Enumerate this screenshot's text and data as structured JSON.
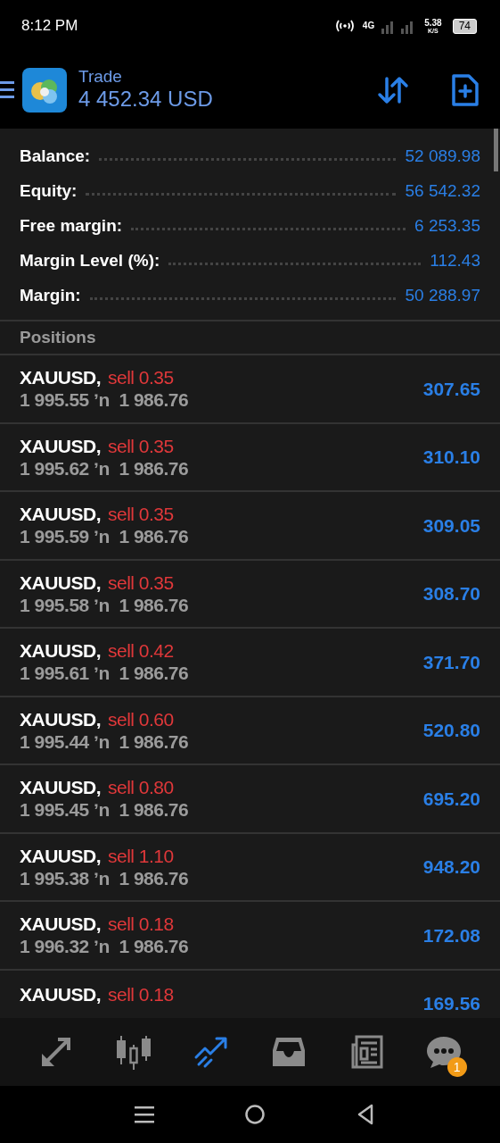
{
  "status_bar": {
    "time": "8:12 PM",
    "network": "4G",
    "speed": "5.38",
    "speed_unit": "K/S",
    "battery": "74"
  },
  "header": {
    "title": "Trade",
    "subtitle": "4 452.34 USD"
  },
  "summary": [
    {
      "label": "Balance:",
      "value": "52 089.98"
    },
    {
      "label": "Equity:",
      "value": "56 542.32"
    },
    {
      "label": "Free margin:",
      "value": "6 253.35"
    },
    {
      "label": "Margin Level (%):",
      "value": "112.43"
    },
    {
      "label": "Margin:",
      "value": "50 288.97"
    }
  ],
  "positions_heading": "Positions",
  "positions": [
    {
      "symbol": "XAUUSD,",
      "order": "sell 0.35",
      "prices": "1 995.55 ʼn  1 986.76",
      "profit": "307.65"
    },
    {
      "symbol": "XAUUSD,",
      "order": "sell 0.35",
      "prices": "1 995.62 ʼn  1 986.76",
      "profit": "310.10"
    },
    {
      "symbol": "XAUUSD,",
      "order": "sell 0.35",
      "prices": "1 995.59 ʼn  1 986.76",
      "profit": "309.05"
    },
    {
      "symbol": "XAUUSD,",
      "order": "sell 0.35",
      "prices": "1 995.58 ʼn  1 986.76",
      "profit": "308.70"
    },
    {
      "symbol": "XAUUSD,",
      "order": "sell 0.42",
      "prices": "1 995.61 ʼn  1 986.76",
      "profit": "371.70"
    },
    {
      "symbol": "XAUUSD,",
      "order": "sell 0.60",
      "prices": "1 995.44 ʼn  1 986.76",
      "profit": "520.80"
    },
    {
      "symbol": "XAUUSD,",
      "order": "sell 0.80",
      "prices": "1 995.45 ʼn  1 986.76",
      "profit": "695.20"
    },
    {
      "symbol": "XAUUSD,",
      "order": "sell 1.10",
      "prices": "1 995.38 ʼn  1 986.76",
      "profit": "948.20"
    },
    {
      "symbol": "XAUUSD,",
      "order": "sell 0.18",
      "prices": "1 996.32 ʼn  1 986.76",
      "profit": "172.08"
    },
    {
      "symbol": "XAUUSD,",
      "order": "sell 0.18",
      "profit": "169.56"
    }
  ],
  "tabs": [
    {
      "kind": "quotes",
      "selected": false
    },
    {
      "kind": "chart",
      "selected": false
    },
    {
      "kind": "trade",
      "selected": true
    },
    {
      "kind": "history",
      "selected": false
    },
    {
      "kind": "news",
      "selected": false
    },
    {
      "kind": "messages",
      "selected": false,
      "badge": "1"
    }
  ]
}
